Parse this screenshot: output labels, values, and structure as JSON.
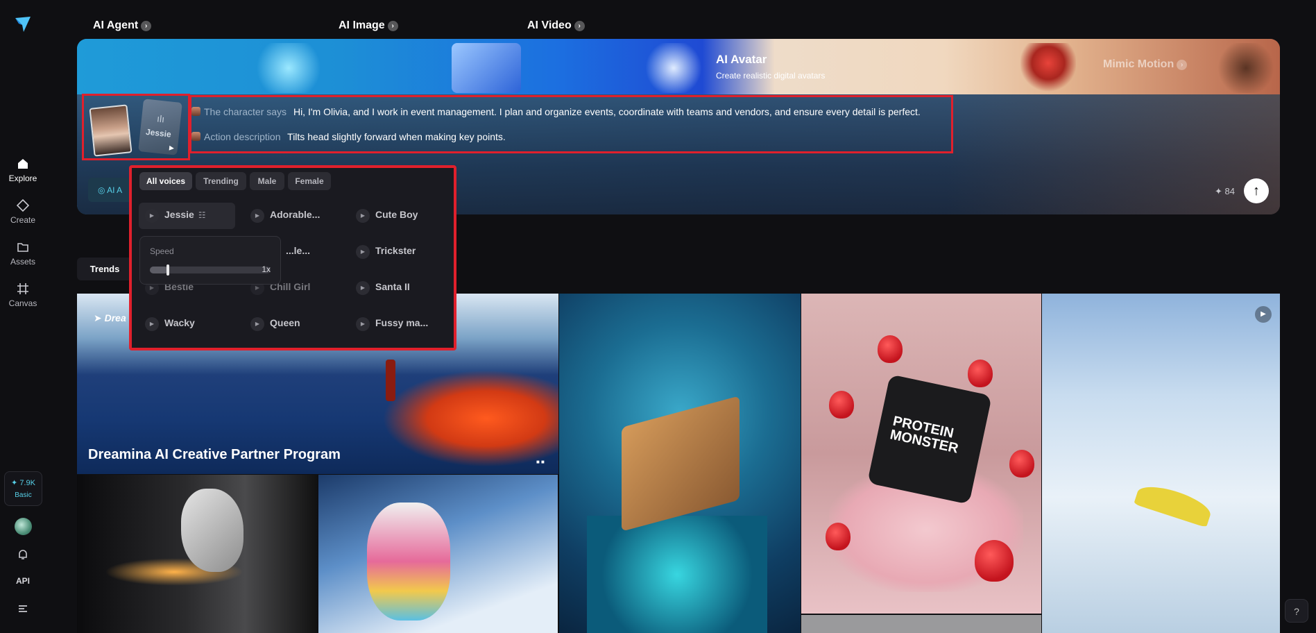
{
  "sidebar": {
    "items": [
      {
        "label": "Explore",
        "icon": "home-icon",
        "active": true
      },
      {
        "label": "Create",
        "icon": "diamond-icon"
      },
      {
        "label": "Assets",
        "icon": "folder-icon"
      },
      {
        "label": "Canvas",
        "icon": "canvas-icon"
      }
    ],
    "credits": "7.9K",
    "plan": "Basic",
    "api": "API"
  },
  "banner": {
    "tabs": [
      {
        "label": "AI Agent"
      },
      {
        "label": "AI Image"
      },
      {
        "label": "AI Video"
      },
      {
        "label": "AI Avatar",
        "subtitle": "Create realistic digital avatars"
      },
      {
        "label": "Mimic Motion"
      }
    ],
    "voice_card_name": "Jessie",
    "prompt": {
      "says_label": "The character says",
      "says_text": "Hi, I'm Olivia, and I work in event management. I plan and organize events, coordinate with teams and vendors, and ensure every detail is perfect.",
      "action_label": "Action description",
      "action_text": "Tilts head slightly forward when making key points."
    },
    "agent_chip": "AI A",
    "credit_cost": "84"
  },
  "voice_picker": {
    "filters": [
      "All voices",
      "Trending",
      "Male",
      "Female"
    ],
    "active_filter": "All voices",
    "voices": [
      [
        "Jessie",
        "Adorable...",
        "Cute Boy"
      ],
      [
        "",
        "...le...",
        "Trickster"
      ],
      [
        "Bestie",
        "Chill Girl",
        "Santa II"
      ],
      [
        "Wacky",
        "Queen",
        "Fussy ma..."
      ]
    ],
    "speed_label": "Speed",
    "speed_value": "1x",
    "speed_fraction": 0.15
  },
  "trends": {
    "tab": "Trends"
  },
  "feed": {
    "hero_title": "Dreamina AI Creative Partner Program",
    "hero_brand": "Drea",
    "protein_label_1": "PROTEIN",
    "protein_label_2": "MONSTER"
  },
  "colors": {
    "accent": "#57d0e8",
    "highlight": "#e0202c"
  }
}
